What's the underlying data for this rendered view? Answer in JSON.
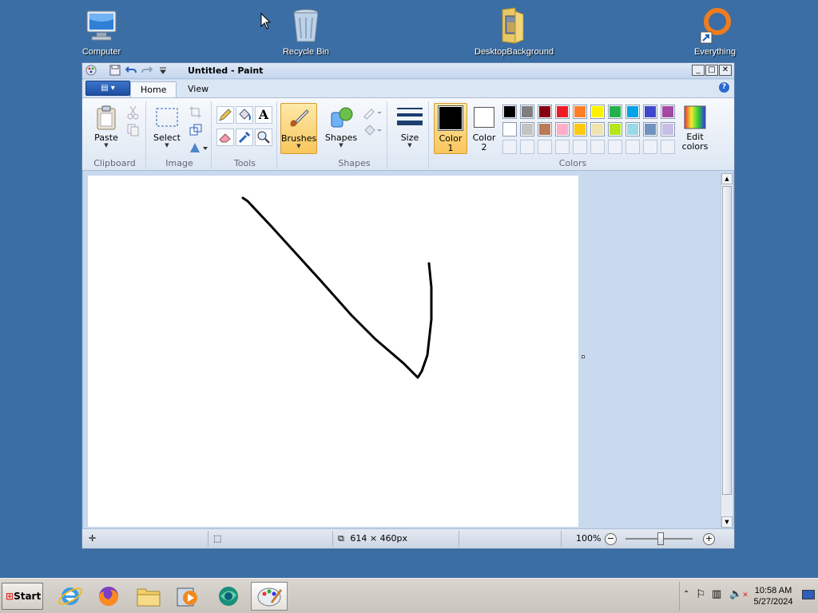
{
  "desktop": {
    "icons": [
      {
        "label": "Computer",
        "icon": "computer-icon"
      },
      {
        "label": "Recycle Bin",
        "icon": "recycle-bin-icon"
      },
      {
        "label": "DesktopBackground",
        "icon": "folder-icon"
      },
      {
        "label": "Everything",
        "icon": "everything-search-icon"
      }
    ]
  },
  "window": {
    "title": "Untitled - Paint",
    "buttons": {
      "minimize": "_",
      "maximize": "□",
      "close": "✕"
    },
    "tabs": [
      {
        "label": "Home",
        "active": true
      },
      {
        "label": "View",
        "active": false
      }
    ],
    "ribbon": {
      "clipboard": {
        "paste": "Paste",
        "label": "Clipboard"
      },
      "image": {
        "select": "Select",
        "label": "Image"
      },
      "tools": {
        "label": "Tools"
      },
      "brushes": {
        "label": "Brushes"
      },
      "shapes": {
        "shapes": "Shapes",
        "label": "Shapes"
      },
      "size": {
        "label": "Size"
      },
      "colors": {
        "color1_line1": "Color",
        "color1_line2": "1",
        "color2_line1": "Color",
        "color2_line2": "2",
        "edit_line1": "Edit",
        "edit_line2": "colors",
        "label": "Colors",
        "color1_value": "#000000",
        "color2_value": "#ffffff",
        "palette_row1": [
          "#000000",
          "#7f7f7f",
          "#880015",
          "#ed1c24",
          "#ff7f27",
          "#fff200",
          "#22b14c",
          "#00a2e8",
          "#3f48cc",
          "#a349a4"
        ],
        "palette_row2": [
          "#ffffff",
          "#c3c3c3",
          "#b97a57",
          "#ffaec9",
          "#ffc90e",
          "#efe4b0",
          "#b5e61d",
          "#99d9ea",
          "#7092be",
          "#c8bfe7"
        ]
      }
    },
    "status": {
      "dimensions": "614 × 460px",
      "zoom": "100%"
    }
  },
  "taskbar": {
    "start": "Start",
    "apps": [
      "internet-explorer-icon",
      "firefox-icon",
      "file-explorer-icon",
      "media-player-icon",
      "browser-icon",
      "paint-icon"
    ],
    "time": "10:58 AM",
    "date": "5/27/2024"
  }
}
